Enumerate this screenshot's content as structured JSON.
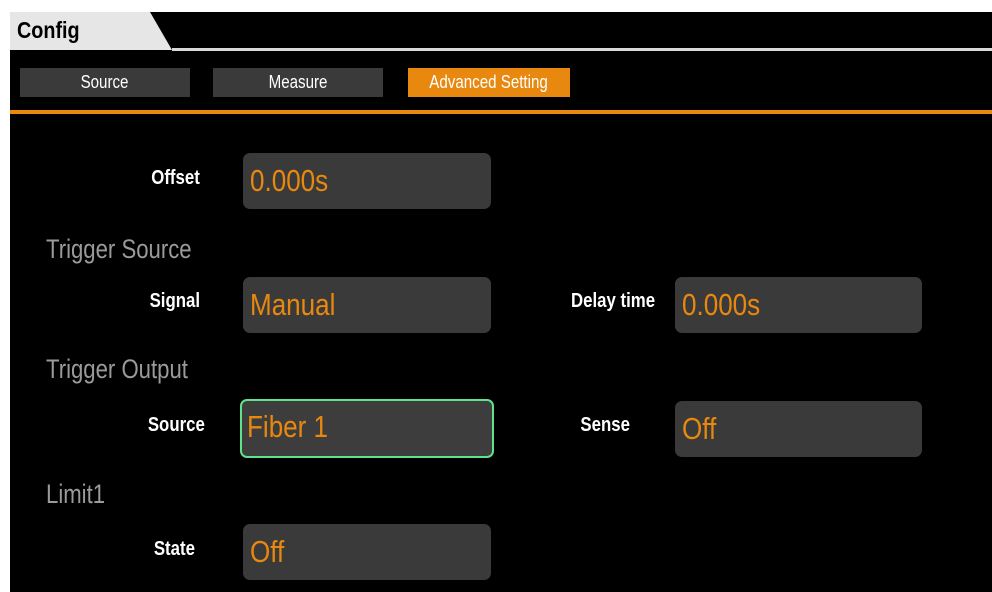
{
  "header": {
    "title": "Config"
  },
  "tabs": [
    {
      "label": "Source",
      "active": false
    },
    {
      "label": "Measure",
      "active": false
    },
    {
      "label": "Advanced Setting",
      "active": true
    }
  ],
  "form": {
    "offset": {
      "label": "Offset",
      "value": "0.000s"
    },
    "trigger_source": {
      "heading": "Trigger Source",
      "signal": {
        "label": "Signal",
        "value": "Manual"
      },
      "delay_time": {
        "label": "Delay time",
        "value": "0.000s"
      }
    },
    "trigger_output": {
      "heading": "Trigger Output",
      "source": {
        "label": "Source",
        "value": "Fiber 1",
        "focused": true
      },
      "sense": {
        "label": "Sense",
        "value": "Off"
      }
    },
    "limit1": {
      "heading": "Limit1",
      "state": {
        "label": "State",
        "value": "Off"
      }
    }
  },
  "colors": {
    "accent": "#e8880f",
    "focus": "#5ee28a",
    "field_bg": "#3a3a3a",
    "section_text": "#9a9a9a",
    "background": "#000000"
  }
}
